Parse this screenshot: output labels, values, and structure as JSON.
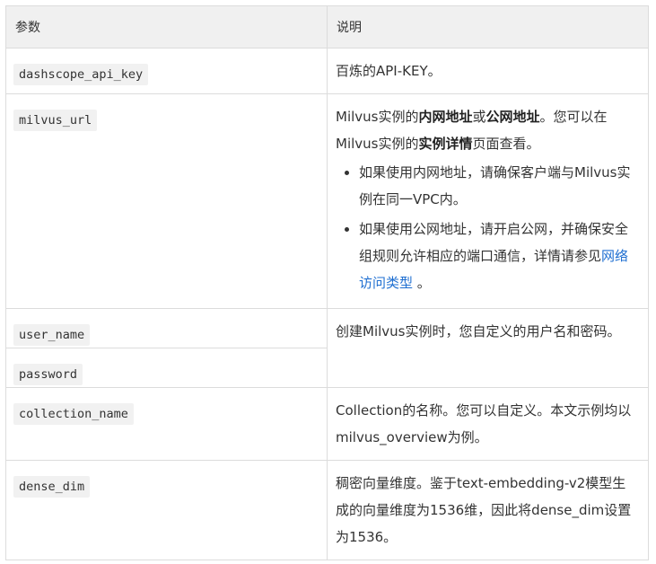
{
  "header": {
    "col_param": "参数",
    "col_desc": "说明"
  },
  "rows": {
    "api_key": {
      "param": "dashscope_api_key",
      "desc": "百炼的API-KEY。"
    },
    "milvus_url": {
      "param": "milvus_url",
      "p1_a": "Milvus实例的",
      "p1_b": "内网地址",
      "p1_c": "或",
      "p1_d": "公网地址",
      "p1_e": "。您可以在Milvus实例的",
      "p1_f": "实例详情",
      "p1_g": "页面查看。",
      "li1": "如果使用内网地址，请确保客户端与Milvus实例在同一VPC内。",
      "li2_a": "如果使用公网地址，请开启公网，并确保安全组规则允许相应的端口通信，详情请参见",
      "li2_link": "网络访问类型",
      "li2_b": "。"
    },
    "user_name": {
      "param": "user_name"
    },
    "password": {
      "param": "password"
    },
    "user_desc": "创建Milvus实例时，您自定义的用户名和密码。",
    "collection_name": {
      "param": "collection_name",
      "desc": "Collection的名称。您可以自定义。本文示例均以milvus_overview为例。"
    },
    "dense_dim": {
      "param": "dense_dim",
      "desc": "稠密向量维度。鉴于text-embedding-v2模型生成的向量维度为1536维，因此将dense_dim设置为1536。"
    }
  }
}
